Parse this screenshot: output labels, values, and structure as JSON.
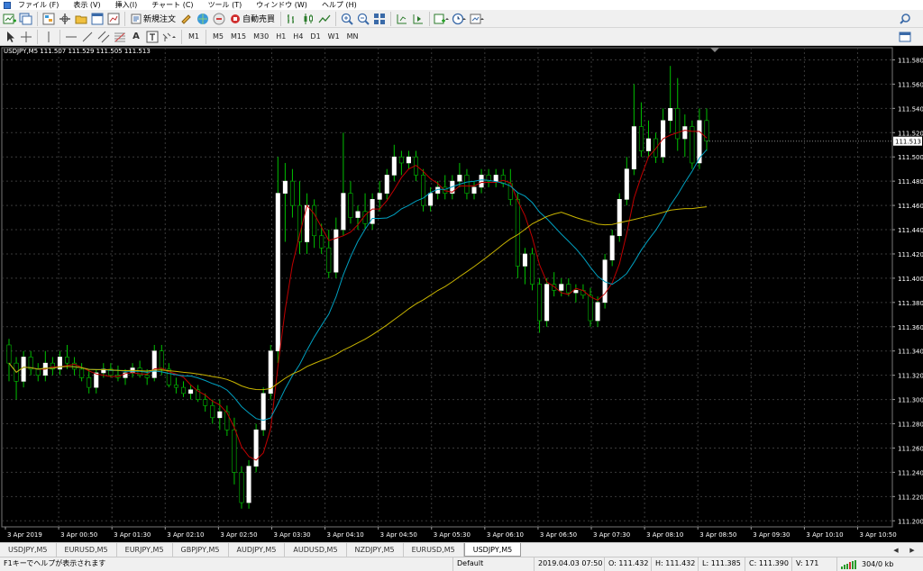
{
  "menu": [
    "ファイル (F)",
    "表示 (V)",
    "挿入(I)",
    "チャート (C)",
    "ツール (T)",
    "ウィンドウ (W)",
    "ヘルプ (H)"
  ],
  "toolbar": {
    "new_order_label": "新規注文",
    "auto_trade_label": "自動売買",
    "timeframes": [
      "M1",
      "M5",
      "M15",
      "M30",
      "H1",
      "H4",
      "D1",
      "W1",
      "MN"
    ]
  },
  "chart": {
    "header": "USDJPY,M5  111.507 111.529 111.505 111.513",
    "y_ticks": [
      "111.580",
      "111.560",
      "111.540",
      "111.520",
      "111.500",
      "111.480",
      "111.460",
      "111.440",
      "111.420",
      "111.400",
      "111.380",
      "111.360",
      "111.340",
      "111.320",
      "111.300",
      "111.280",
      "111.260",
      "111.240",
      "111.220",
      "111.200"
    ],
    "x_ticks": [
      "3 Apr 2019",
      "3 Apr 00:50",
      "3 Apr 01:30",
      "3 Apr 02:10",
      "3 Apr 02:50",
      "3 Apr 03:30",
      "3 Apr 04:10",
      "3 Apr 04:50",
      "3 Apr 05:30",
      "3 Apr 06:10",
      "3 Apr 06:50",
      "3 Apr 07:30",
      "3 Apr 08:10",
      "3 Apr 08:50",
      "3 Apr 09:30",
      "3 Apr 10:10",
      "3 Apr 10:50"
    ],
    "current_price": "111.513",
    "colors": {
      "background": "#000000",
      "up_candle": "#ffffff",
      "down_candle": "#000000",
      "wick": "#00c000",
      "ma_fast": "#c00000",
      "ma_mid": "#00a0c0",
      "ma_slow": "#c8b400",
      "grid": "#3a3a3a"
    }
  },
  "chart_data": {
    "type": "candlestick",
    "symbol": "USDJPY",
    "timeframe": "M5",
    "ylim": [
      111.195,
      111.59
    ],
    "candles": [
      [
        111.345,
        111.35,
        111.315,
        111.33
      ],
      [
        111.33,
        111.335,
        111.3,
        111.315
      ],
      [
        111.315,
        111.34,
        111.31,
        111.335
      ],
      [
        111.335,
        111.34,
        111.32,
        111.325
      ],
      [
        111.325,
        111.33,
        111.315,
        111.32
      ],
      [
        111.32,
        111.34,
        111.315,
        111.33
      ],
      [
        111.33,
        111.335,
        111.32,
        111.325
      ],
      [
        111.325,
        111.34,
        111.32,
        111.335
      ],
      [
        111.335,
        111.345,
        111.325,
        111.33
      ],
      [
        111.33,
        111.335,
        111.32,
        111.325
      ],
      [
        111.325,
        111.33,
        111.315,
        111.318
      ],
      [
        111.318,
        111.325,
        111.305,
        111.31
      ],
      [
        111.31,
        111.325,
        111.305,
        111.322
      ],
      [
        111.322,
        111.33,
        111.318,
        111.325
      ],
      [
        111.325,
        111.33,
        111.318,
        111.32
      ],
      [
        111.32,
        111.328,
        111.315,
        111.318
      ],
      [
        111.318,
        111.325,
        111.312,
        111.322
      ],
      [
        111.322,
        111.33,
        111.318,
        111.326
      ],
      [
        111.326,
        111.332,
        111.318,
        111.32
      ],
      [
        111.32,
        111.325,
        111.312,
        111.318
      ],
      [
        111.318,
        111.345,
        111.315,
        111.34
      ],
      [
        111.34,
        111.345,
        111.32,
        111.325
      ],
      [
        111.325,
        111.33,
        111.31,
        111.312
      ],
      [
        111.312,
        111.318,
        111.305,
        111.31
      ],
      [
        111.31,
        111.315,
        111.302,
        111.305
      ],
      [
        111.305,
        111.312,
        111.3,
        111.308
      ],
      [
        111.308,
        111.312,
        111.298,
        111.3
      ],
      [
        111.3,
        111.305,
        111.29,
        111.295
      ],
      [
        111.295,
        111.3,
        111.28,
        111.285
      ],
      [
        111.285,
        111.3,
        111.275,
        111.29
      ],
      [
        111.29,
        111.295,
        111.27,
        111.275
      ],
      [
        111.275,
        111.285,
        111.23,
        111.24
      ],
      [
        111.24,
        111.245,
        111.21,
        111.215
      ],
      [
        111.215,
        111.25,
        111.21,
        111.245
      ],
      [
        111.245,
        111.28,
        111.24,
        111.275
      ],
      [
        111.275,
        111.31,
        111.27,
        111.305
      ],
      [
        111.305,
        111.345,
        111.3,
        111.34
      ],
      [
        111.34,
        111.5,
        111.33,
        111.47
      ],
      [
        111.47,
        111.495,
        111.43,
        111.48
      ],
      [
        111.48,
        111.49,
        111.45,
        111.46
      ],
      [
        111.46,
        111.48,
        111.42,
        111.43
      ],
      [
        111.43,
        111.47,
        111.42,
        111.46
      ],
      [
        111.46,
        111.465,
        111.425,
        111.435
      ],
      [
        111.435,
        111.445,
        111.42,
        111.425
      ],
      [
        111.425,
        111.44,
        111.4,
        111.405
      ],
      [
        111.405,
        111.45,
        111.4,
        111.44
      ],
      [
        111.44,
        111.52,
        111.435,
        111.47
      ],
      [
        111.47,
        111.48,
        111.445,
        111.45
      ],
      [
        111.45,
        111.46,
        111.44,
        111.455
      ],
      [
        111.455,
        111.47,
        111.44,
        111.445
      ],
      [
        111.445,
        111.47,
        111.44,
        111.465
      ],
      [
        111.465,
        111.48,
        111.455,
        111.47
      ],
      [
        111.47,
        111.49,
        111.465,
        111.485
      ],
      [
        111.485,
        111.51,
        111.48,
        111.5
      ],
      [
        111.5,
        111.505,
        111.485,
        111.495
      ],
      [
        111.495,
        111.505,
        111.49,
        111.5
      ],
      [
        111.5,
        111.505,
        111.48,
        111.485
      ],
      [
        111.485,
        111.49,
        111.455,
        111.46
      ],
      [
        111.46,
        111.475,
        111.455,
        111.47
      ],
      [
        111.47,
        111.48,
        111.465,
        111.475
      ],
      [
        111.475,
        111.485,
        111.465,
        111.47
      ],
      [
        111.47,
        111.485,
        111.465,
        111.48
      ],
      [
        111.48,
        111.495,
        111.475,
        111.485
      ],
      [
        111.485,
        111.49,
        111.465,
        111.47
      ],
      [
        111.47,
        111.48,
        111.465,
        111.475
      ],
      [
        111.475,
        111.49,
        111.47,
        111.485
      ],
      [
        111.485,
        111.49,
        111.475,
        111.48
      ],
      [
        111.48,
        111.49,
        111.475,
        111.485
      ],
      [
        111.485,
        111.49,
        111.475,
        111.478
      ],
      [
        111.478,
        111.49,
        111.46,
        111.465
      ],
      [
        111.465,
        111.47,
        111.4,
        111.41
      ],
      [
        111.41,
        111.425,
        111.395,
        111.42
      ],
      [
        111.42,
        111.425,
        111.39,
        111.395
      ],
      [
        111.395,
        111.4,
        111.355,
        111.365
      ],
      [
        111.365,
        111.4,
        111.36,
        111.395
      ],
      [
        111.395,
        111.405,
        111.385,
        111.39
      ],
      [
        111.39,
        111.4,
        111.385,
        111.395
      ],
      [
        111.395,
        111.4,
        111.385,
        111.388
      ],
      [
        111.388,
        111.395,
        111.38,
        111.39
      ],
      [
        111.39,
        111.395,
        111.383,
        111.386
      ],
      [
        111.386,
        111.392,
        111.36,
        111.365
      ],
      [
        111.365,
        111.385,
        111.36,
        111.38
      ],
      [
        111.38,
        111.42,
        111.375,
        111.415
      ],
      [
        111.415,
        111.44,
        111.41,
        111.435
      ],
      [
        111.435,
        111.47,
        111.43,
        111.465
      ],
      [
        111.465,
        111.5,
        111.46,
        111.49
      ],
      [
        111.49,
        111.56,
        111.485,
        111.525
      ],
      [
        111.525,
        111.545,
        111.5,
        111.505
      ],
      [
        111.505,
        111.53,
        111.5,
        111.515
      ],
      [
        111.515,
        111.52,
        111.495,
        111.5
      ],
      [
        111.5,
        111.54,
        111.495,
        111.53
      ],
      [
        111.53,
        111.575,
        111.52,
        111.54
      ],
      [
        111.54,
        111.565,
        111.505,
        111.515
      ],
      [
        111.515,
        111.535,
        111.5,
        111.525
      ],
      [
        111.525,
        111.53,
        111.49,
        111.495
      ],
      [
        111.495,
        111.54,
        111.49,
        111.53
      ],
      [
        111.53,
        111.54,
        111.505,
        111.513
      ]
    ]
  },
  "tabs": [
    "USDJPY,M5",
    "EURUSD,M5",
    "EURJPY,M5",
    "GBPJPY,M5",
    "AUDJPY,M5",
    "AUDUSD,M5",
    "NZDJPY,M5",
    "EURUSD,M5",
    "USDJPY,M5"
  ],
  "active_tab_index": 8,
  "status": {
    "help": "F1キーでヘルプが表示されます",
    "profile": "Default",
    "datetime": "2019.04.03 07:50",
    "open": "O: 111.432",
    "high": "H: 111.432",
    "low": "L: 111.385",
    "close": "C: 111.390",
    "volume": "V: 171",
    "traffic": "304/0 kb"
  }
}
